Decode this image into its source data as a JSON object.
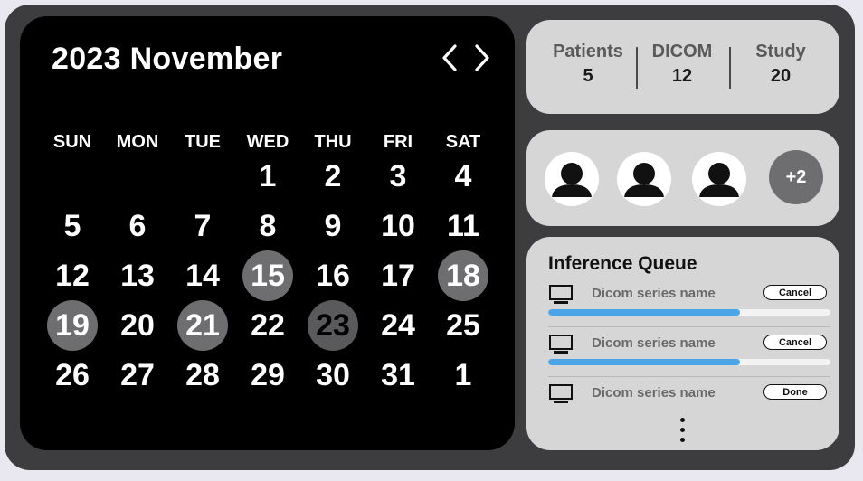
{
  "calendar": {
    "title": "2023 November",
    "weekdays": [
      "SUN",
      "MON",
      "TUE",
      "WED",
      "THU",
      "FRI",
      "SAT"
    ],
    "days": [
      {
        "label": "1",
        "col": 3,
        "row": 0
      },
      {
        "label": "2",
        "col": 4,
        "row": 0
      },
      {
        "label": "3",
        "col": 5,
        "row": 0
      },
      {
        "label": "4",
        "col": 6,
        "row": 0
      },
      {
        "label": "5",
        "col": 0,
        "row": 1
      },
      {
        "label": "6",
        "col": 1,
        "row": 1
      },
      {
        "label": "7",
        "col": 2,
        "row": 1
      },
      {
        "label": "8",
        "col": 3,
        "row": 1
      },
      {
        "label": "9",
        "col": 4,
        "row": 1
      },
      {
        "label": "10",
        "col": 5,
        "row": 1
      },
      {
        "label": "11",
        "col": 6,
        "row": 1
      },
      {
        "label": "12",
        "col": 0,
        "row": 2
      },
      {
        "label": "13",
        "col": 1,
        "row": 2
      },
      {
        "label": "14",
        "col": 2,
        "row": 2
      },
      {
        "label": "15",
        "col": 3,
        "row": 2,
        "highlight": "light"
      },
      {
        "label": "16",
        "col": 4,
        "row": 2
      },
      {
        "label": "17",
        "col": 5,
        "row": 2
      },
      {
        "label": "18",
        "col": 6,
        "row": 2,
        "highlight": "light"
      },
      {
        "label": "19",
        "col": 0,
        "row": 3,
        "highlight": "light"
      },
      {
        "label": "20",
        "col": 1,
        "row": 3
      },
      {
        "label": "21",
        "col": 2,
        "row": 3,
        "highlight": "light"
      },
      {
        "label": "22",
        "col": 3,
        "row": 3
      },
      {
        "label": "23",
        "col": 4,
        "row": 3,
        "highlight": "dark"
      },
      {
        "label": "24",
        "col": 5,
        "row": 3
      },
      {
        "label": "25",
        "col": 6,
        "row": 3
      },
      {
        "label": "26",
        "col": 0,
        "row": 4
      },
      {
        "label": "27",
        "col": 1,
        "row": 4
      },
      {
        "label": "28",
        "col": 2,
        "row": 4
      },
      {
        "label": "29",
        "col": 3,
        "row": 4
      },
      {
        "label": "30",
        "col": 4,
        "row": 4
      },
      {
        "label": "31",
        "col": 5,
        "row": 4
      },
      {
        "label": "1",
        "col": 6,
        "row": 4
      }
    ]
  },
  "stats": {
    "patients_label": "Patients",
    "patients_value": "5",
    "dicom_label": "DICOM",
    "dicom_value": "12",
    "study_label": "Study",
    "study_value": "20"
  },
  "team": {
    "avatars": [
      "person-icon",
      "person-icon",
      "person-icon"
    ],
    "more_label": "+2"
  },
  "queue": {
    "title": "Inference Queue",
    "items": [
      {
        "name": "Dicom series name",
        "action": "Cancel",
        "progress": 0.68
      },
      {
        "name": "Dicom series name",
        "action": "Cancel",
        "progress": 0.68
      },
      {
        "name": "Dicom series name",
        "action": "Done"
      }
    ]
  },
  "colors": {
    "frame": "#3d3d3f",
    "calendar_bg": "#000000",
    "card_bg": "#d6d6d6",
    "highlight": "#6e6e70",
    "progress": "#4aa5e8"
  }
}
